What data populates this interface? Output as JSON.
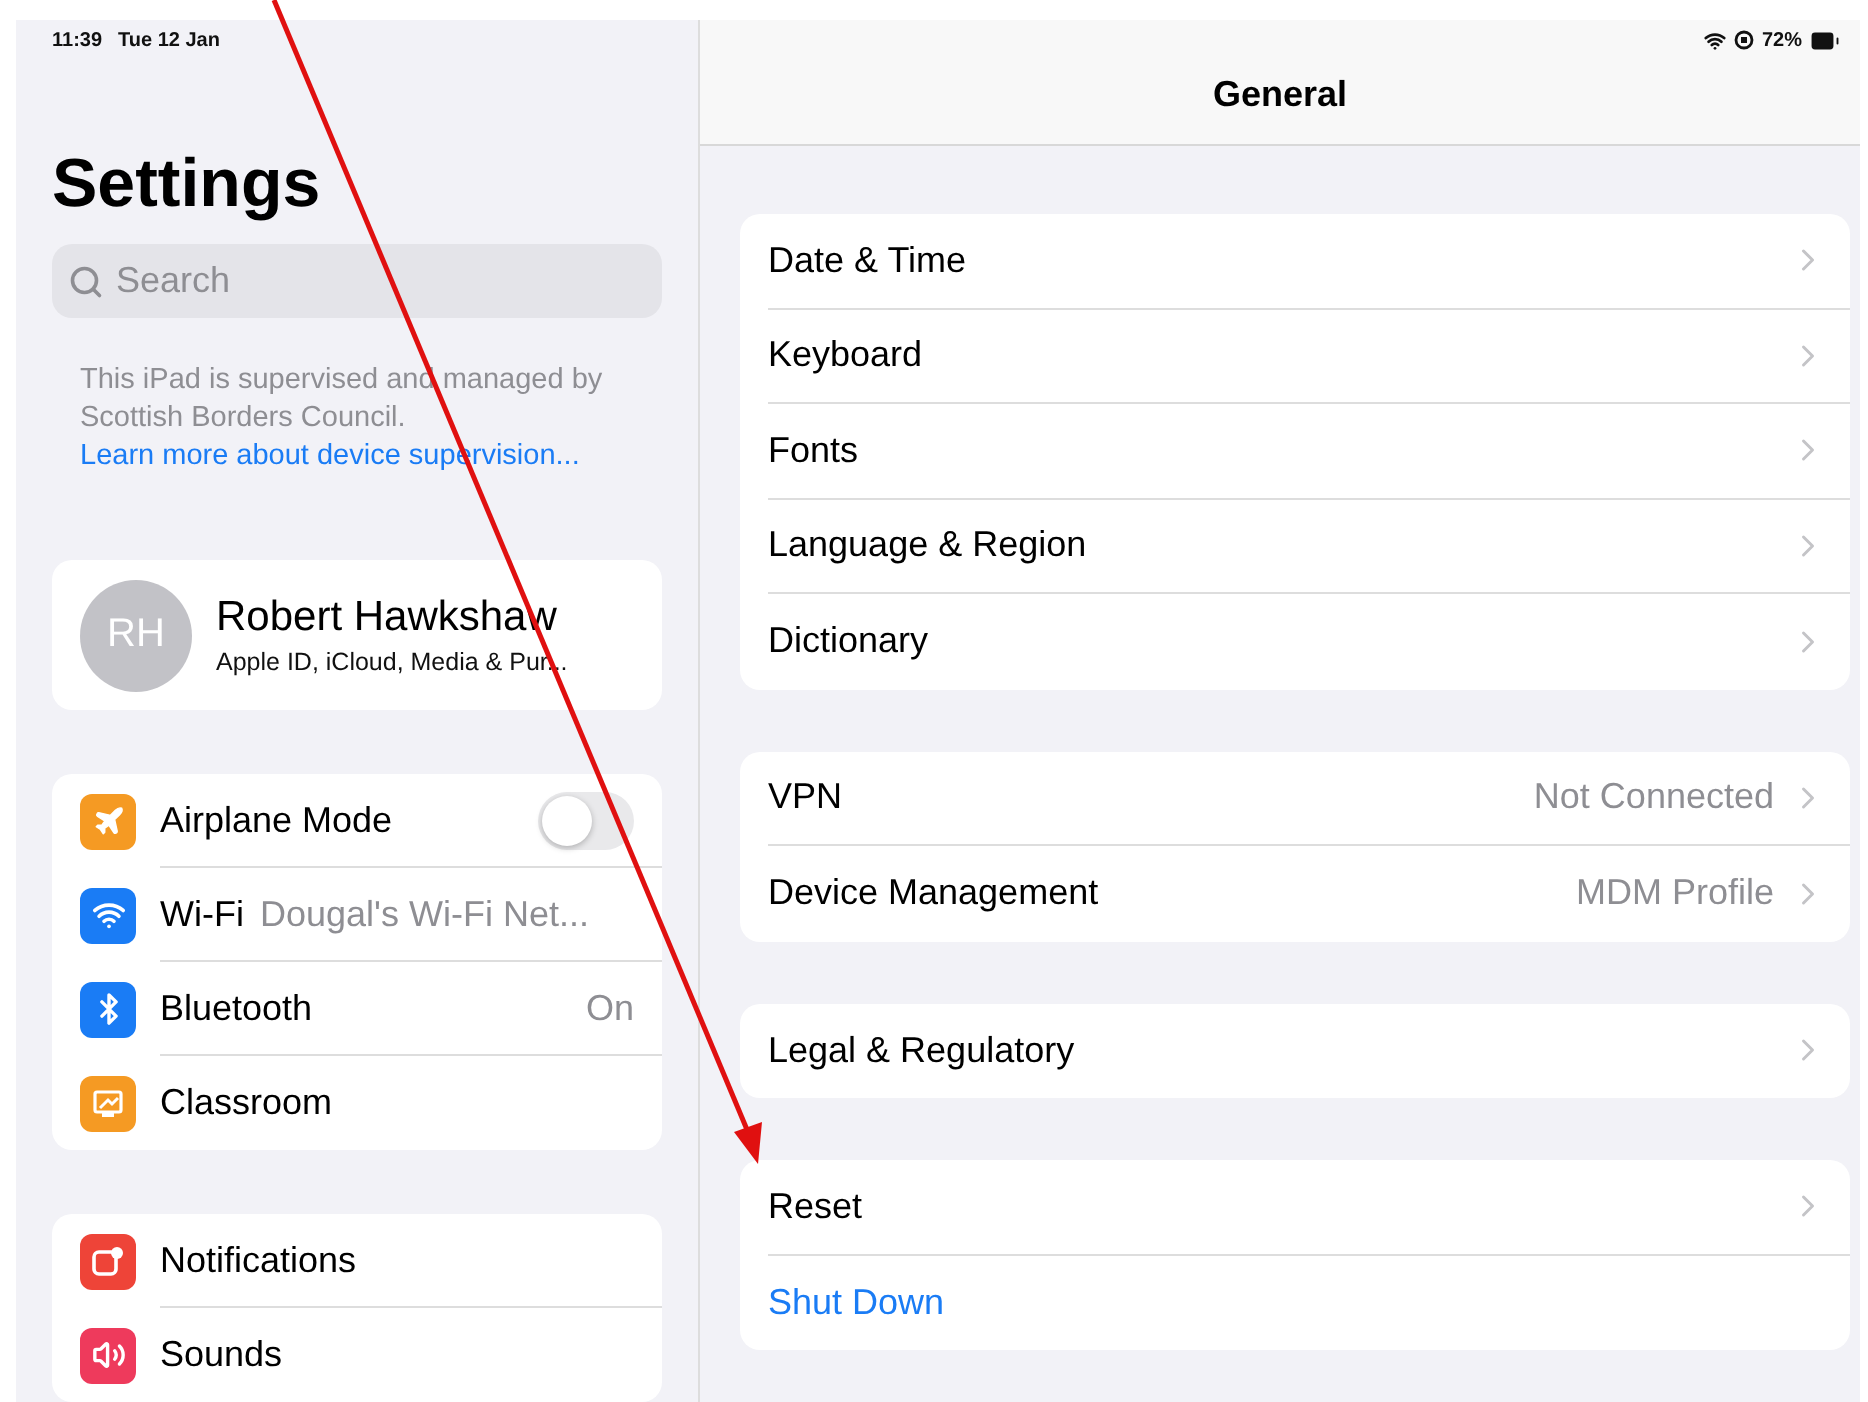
{
  "status_bar": {
    "time": "11:39",
    "date": "Tue 12 Jan",
    "battery": "72%"
  },
  "sidebar": {
    "title": "Settings",
    "search": {
      "placeholder": "Search"
    },
    "notice": {
      "text": "This iPad is supervised and managed by Scottish Borders Council.",
      "link": "Learn more about device supervision..."
    },
    "profile": {
      "initials": "RH",
      "name": "Robert Hawkshaw",
      "subtitle": "Apple ID, iCloud, Media & Pur..."
    },
    "groups": [
      [
        {
          "kind": "toggle",
          "label": "Airplane Mode",
          "on": false,
          "color": "#f59a23"
        },
        {
          "kind": "value",
          "label": "Wi-Fi",
          "value": "Dougal's Wi-Fi Net...",
          "color": "#1a7cf5"
        },
        {
          "kind": "value",
          "label": "Bluetooth",
          "value": "On",
          "color": "#1a7cf5"
        },
        {
          "kind": "value",
          "label": "Classroom",
          "color": "#f59a23"
        }
      ],
      [
        {
          "kind": "value",
          "label": "Notifications",
          "color": "#ee4438"
        },
        {
          "kind": "value",
          "label": "Sounds",
          "color": "#ee3a5c"
        }
      ]
    ]
  },
  "detail": {
    "title": "General",
    "groups": [
      [
        {
          "kind": "link",
          "label": "Date & Time"
        },
        {
          "kind": "link",
          "label": "Keyboard"
        },
        {
          "kind": "link",
          "label": "Fonts"
        },
        {
          "kind": "link",
          "label": "Language & Region"
        },
        {
          "kind": "link",
          "label": "Dictionary"
        }
      ],
      [
        {
          "kind": "link",
          "label": "VPN",
          "value": "Not Connected"
        },
        {
          "kind": "link",
          "label": "Device Management",
          "value": "MDM Profile"
        }
      ],
      [
        {
          "kind": "link",
          "label": "Legal & Regulatory"
        }
      ],
      [
        {
          "kind": "link",
          "label": "Reset"
        },
        {
          "kind": "action",
          "label": "Shut Down"
        }
      ]
    ]
  },
  "annotation_arrow": {
    "color": "#e01010"
  }
}
